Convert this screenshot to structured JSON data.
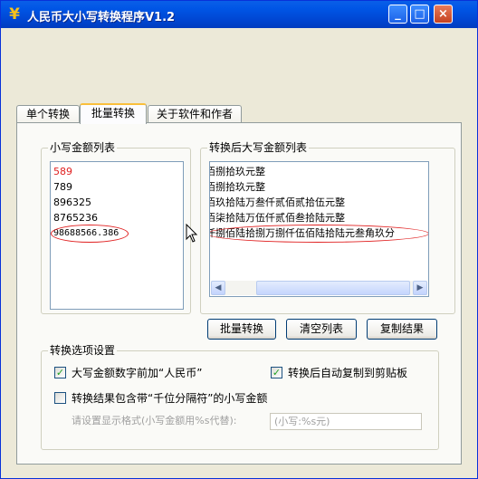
{
  "window": {
    "title": "人民币大小写转换程序V1.2",
    "controls": {
      "minimize": "_",
      "maximize": "□",
      "close": "×"
    }
  },
  "tabs": [
    {
      "label": "单个转换",
      "active": false
    },
    {
      "label": "批量转换",
      "active": true
    },
    {
      "label": "关于软件和作者",
      "active": false
    }
  ],
  "lower_list": {
    "title": "小写金额列表",
    "items": [
      "589",
      "789",
      "896325",
      "8765236",
      "98688566.386"
    ]
  },
  "upper_list": {
    "title": "转换后大写金额列表",
    "items": [
      "伍佰捌拾玖元整",
      "柒佰捌拾玖元整",
      "捌佰玖拾陆万叁仟贰佰贰拾伍元整",
      "捌佰柒拾陆万伍仟贰佰叁拾陆元整",
      "玖仟捌佰陆拾捌万捌仟伍佰陆拾陆元叁角玖分"
    ]
  },
  "buttons": {
    "batch_convert": "批量转换",
    "clear_list": "清空列表",
    "copy_result": "复制结果"
  },
  "options": {
    "title": "转换选项设置",
    "prefix_rmb": {
      "label": "大写金额数字前加“人民币”",
      "checked": true
    },
    "auto_copy": {
      "label": "转换后自动复制到剪贴板",
      "checked": true
    },
    "thousands_sep": {
      "label": "转换结果包含带“千位分隔符”的小写金额",
      "checked": false
    },
    "format_label": "请设置显示格式(小写金额用%s代替):",
    "format_value": "(小写:%s元)"
  },
  "colors": {
    "title_bar": "#0055e5",
    "highlight_red": "#e02020",
    "tab_active_accent": "#fabf3b"
  }
}
